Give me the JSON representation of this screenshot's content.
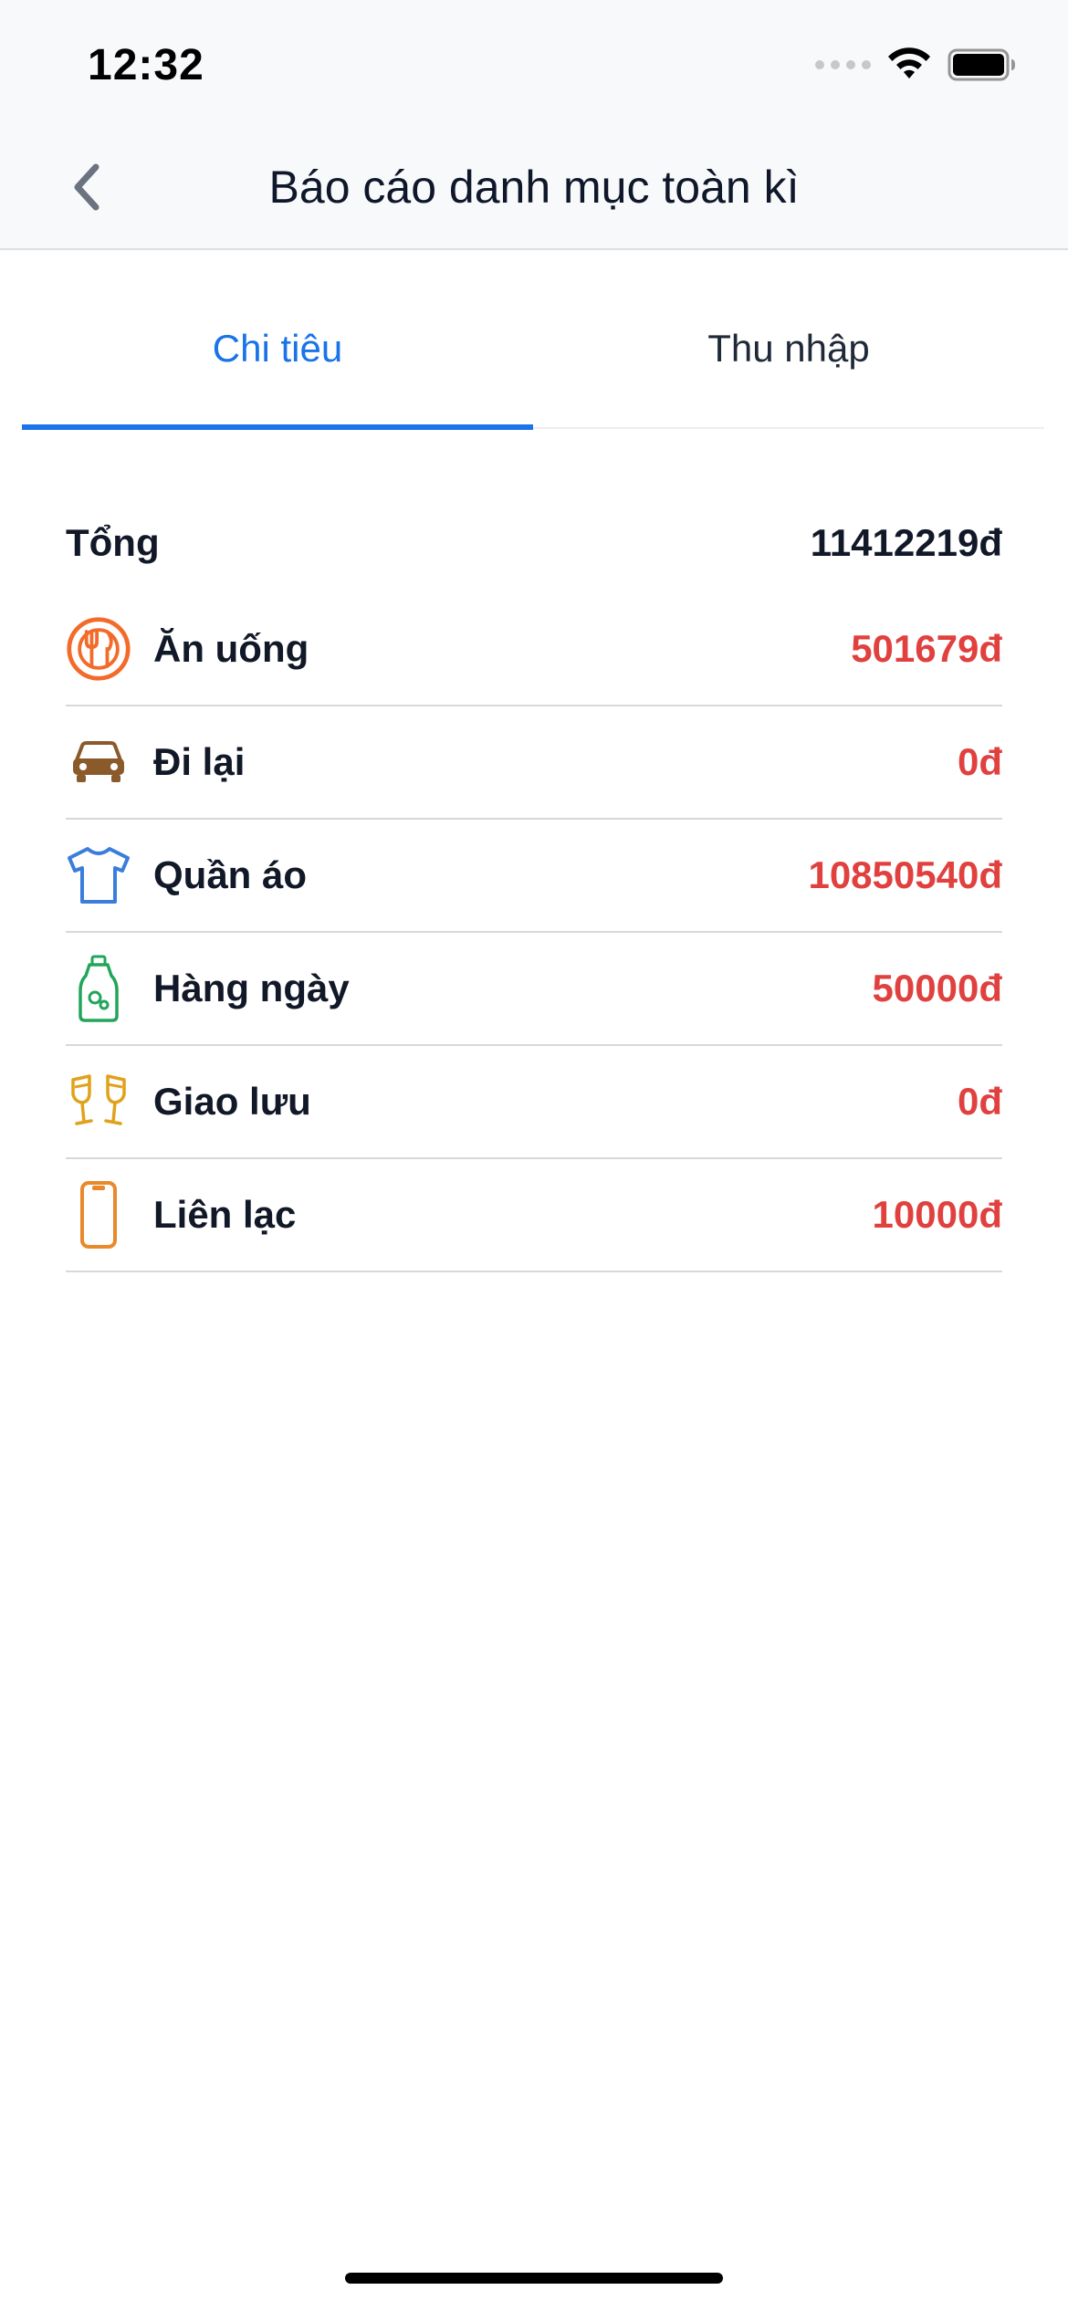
{
  "status_bar": {
    "time": "12:32"
  },
  "nav": {
    "title": "Báo cáo danh mục toàn kì"
  },
  "tabs": [
    {
      "label": "Chi tiêu",
      "active": true
    },
    {
      "label": "Thu nhập",
      "active": false
    }
  ],
  "summary": {
    "label": "Tổng",
    "value": "11412219đ"
  },
  "items": [
    {
      "label": "Ăn uống",
      "value": "501679đ",
      "icon": "food-icon",
      "color": "#f26b2a"
    },
    {
      "label": "Đi lại",
      "value": "0đ",
      "icon": "car-icon",
      "color": "#8b5a2b"
    },
    {
      "label": "Quần áo",
      "value": "10850540đ",
      "icon": "tshirt-icon",
      "color": "#3b7ddd"
    },
    {
      "label": "Hàng ngày",
      "value": "50000đ",
      "icon": "detergent-bottle-icon",
      "color": "#22a55a"
    },
    {
      "label": "Giao lưu",
      "value": "0đ",
      "icon": "cheers-glasses-icon",
      "color": "#e0a21b"
    },
    {
      "label": "Liên lạc",
      "value": "10000đ",
      "icon": "phone-icon",
      "color": "#e8892b"
    }
  ],
  "colors": {
    "accent": "#1a73e8",
    "amount": "#e0413f"
  }
}
